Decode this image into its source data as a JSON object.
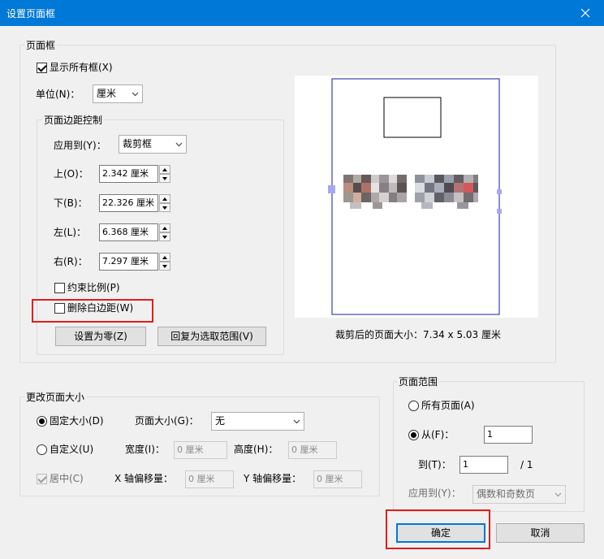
{
  "window": {
    "title": "设置页面框",
    "close_icon": "close-icon"
  },
  "page_box": {
    "legend": "页面框",
    "show_all": {
      "label": "显示所有框(X)",
      "checked": true
    },
    "unit": {
      "label": "单位(N)：",
      "value": "厘米"
    },
    "margins": {
      "legend": "页面边距控制",
      "apply_to": {
        "label": "应用到(Y)：",
        "value": "裁剪框"
      },
      "top": {
        "label": "上(O)：",
        "value": "2.342 厘米"
      },
      "bottom": {
        "label": "下(B)：",
        "value": "22.326 厘米"
      },
      "left": {
        "label": "左(L)：",
        "value": "6.368 厘米"
      },
      "right": {
        "label": "右(R)：",
        "value": "7.297 厘米"
      },
      "constrain": {
        "label": "约束比例(P)",
        "checked": false
      },
      "remove_white": {
        "label": "删除白边距(W)",
        "checked": false
      },
      "set_zero_button": "设置为零(Z)",
      "revert_button": "回复为选取范围(V)"
    },
    "preview": {
      "caption": "裁剪后的页面大小：7.34 x 5.03 厘米"
    }
  },
  "resize": {
    "legend": "更改页面大小",
    "fixed": {
      "label": "固定大小(D)",
      "selected": true
    },
    "page_size": {
      "label": "页面大小(G)：",
      "value": "无"
    },
    "custom": {
      "label": "自定义(U)",
      "selected": false
    },
    "width": {
      "label": "宽度(I)：",
      "value": "0 厘米"
    },
    "height": {
      "label": "高度(H)：",
      "value": "0 厘米"
    },
    "center": {
      "label": "居中(C)",
      "checked": true
    },
    "x_offset": {
      "label": "X 轴偏移量：",
      "value": "0 厘米"
    },
    "y_offset": {
      "label": "Y 轴偏移量：",
      "value": "0 厘米"
    }
  },
  "page_range": {
    "legend": "页面范围",
    "all_pages": {
      "label": "所有页面(A)",
      "selected": false
    },
    "from": {
      "label": "从(F)：",
      "value": "1",
      "selected": true
    },
    "to": {
      "label": "到(T)：",
      "value": "1",
      "total": "/ 1"
    },
    "apply_to": {
      "label": "应用到(Y)：",
      "value": "偶数和奇数页"
    }
  },
  "buttons": {
    "ok": "确定",
    "cancel": "取消"
  },
  "colors": {
    "title_bar": "#0078d7",
    "highlight": "#e01e1e",
    "preview_border": "#1a1aa6"
  }
}
